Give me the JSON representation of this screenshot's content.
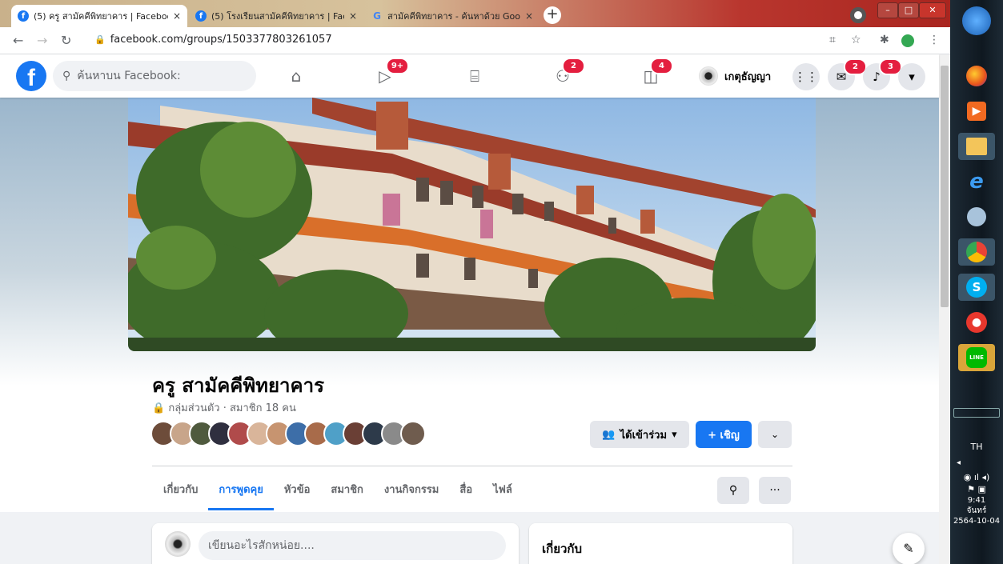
{
  "browser": {
    "tabs": [
      {
        "title": "(5) ครู สามัคคีพิทยาคาร | Facebook",
        "icon": "facebook-icon",
        "active": true
      },
      {
        "title": "(5) โรงเรียนสามัคคีพิทยาคาร | Face",
        "icon": "facebook-icon",
        "active": false
      },
      {
        "title": "สามัคคีพิทยาคาร - ค้นหาด้วย Goo",
        "icon": "google-icon",
        "active": false
      }
    ],
    "tab_close": "×",
    "new_tab": "+",
    "url": "facebook.com/groups/1503377803261057"
  },
  "facebook": {
    "search_placeholder": "ค้นหาบน Facebook:",
    "badges": {
      "watch": "9+",
      "groups": "2",
      "gaming": "4",
      "messenger": "2",
      "notifications": "3"
    },
    "user_name": "เกตุธัญญา"
  },
  "group": {
    "name": "ครู สามัคคีพิทยาคาร",
    "privacy": "กลุ่มส่วนตัว · สมาชิก 18 คน",
    "joined_label": "ได้เข้าร่วม",
    "invite_label": "+ เชิญ",
    "tabs": [
      "เกี่ยวกับ",
      "การพูดคุย",
      "หัวข้อ",
      "สมาชิก",
      "งานกิจกรรม",
      "สื่อ",
      "ไฟล์"
    ],
    "active_tab": "การพูดคุย",
    "composer_placeholder": "เขียนอะไรสักหน่อย....",
    "about_heading": "เกี่ยวกับ"
  },
  "taskbar": {
    "lang": "TH",
    "time": "9:41",
    "day": "จันทร์",
    "date": "2564-10-04"
  },
  "colors": {
    "fb_blue": "#1877f2",
    "badge_red": "#e41e3f"
  }
}
